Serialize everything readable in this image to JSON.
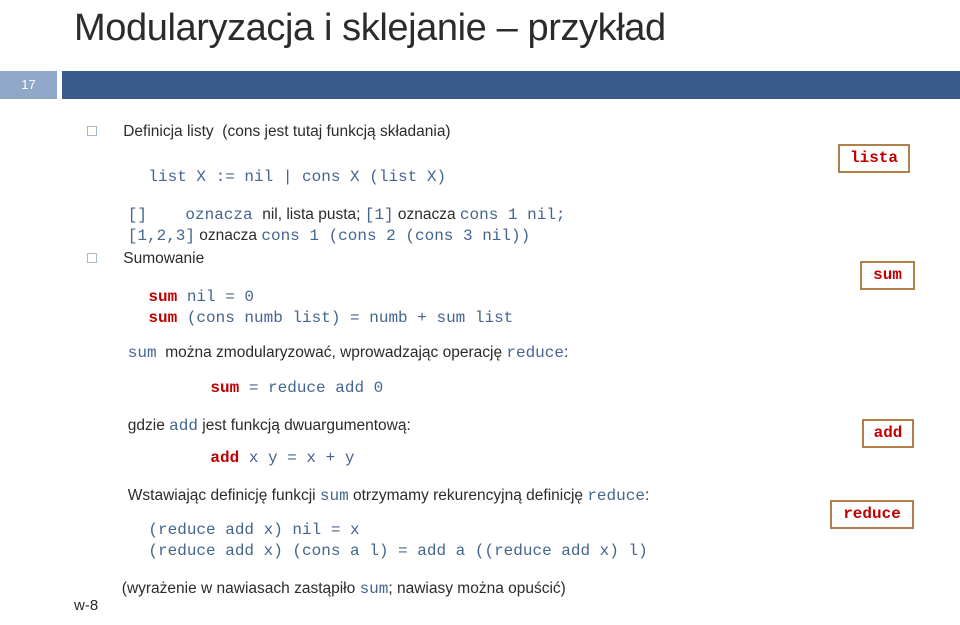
{
  "slide": {
    "title": "Modularyzacja i sklejanie – przykład",
    "number": "17",
    "footer": "w-8"
  },
  "colors": {
    "header_bar": "#3a5a8c",
    "number_box": "#8fa8c8",
    "code_blue": "#44658f",
    "keyword_red": "#c00000",
    "tag_border": "#b07f4a",
    "bullet_border": "#a8b7cc",
    "title": "#2b2b2b"
  },
  "bullets": [
    {
      "label": "Definicja listy  (cons jest tutaj funkcją składania)"
    },
    {
      "label": "Sumowanie"
    }
  ],
  "lines": {
    "list_def": "list X := nil | cons X (list X)",
    "notation_1_a": "[]",
    "notation_1_b": "    oznacza ",
    "notation_1_c": "nil",
    "notation_1_d": ", lista pusta; ",
    "notation_1_e": "[1]",
    "notation_1_f": " oznacza ",
    "notation_1_g": "cons 1 nil;",
    "notation_2_a": "[1,2,3]",
    "notation_2_b": " oznacza ",
    "notation_2_c": "cons 1 (cons 2 (cons 3 nil))",
    "sum_kw": "sum",
    "sum_nil": " nil = 0",
    "sum_cons": " (cons numb list) = numb + sum list",
    "modular_a": "sum",
    "modular_b": "  można zmodularyzować, wprowadzając operację ",
    "modular_c": "reduce",
    "modular_d": ":",
    "sum_eq_a": "sum",
    "sum_eq_b": " = reduce add 0",
    "gdzie_a": "gdzie ",
    "gdzie_b": "add",
    "gdzie_c": " jest funkcją dwuargumentową:",
    "add_a": "add",
    "add_b": " x y = x + y",
    "wstaw_a": "Wstawiając definicję funkcji ",
    "wstaw_b": "sum",
    "wstaw_c": " otrzymamy rekurencyjną definicję ",
    "wstaw_d": "reduce",
    "wstaw_e": ":",
    "reduce_1": "(reduce add x) nil = x",
    "reduce_2": "(reduce add x) (cons a l) = add a ((reduce add x) l)",
    "closing_a": "(wyrażenie w nawiasach zastąpiło ",
    "closing_b": "sum",
    "closing_c": "; nawiasy można opuścić)"
  },
  "tags": [
    {
      "label": "lista"
    },
    {
      "label": "sum"
    },
    {
      "label": "add"
    },
    {
      "label": "reduce"
    }
  ]
}
